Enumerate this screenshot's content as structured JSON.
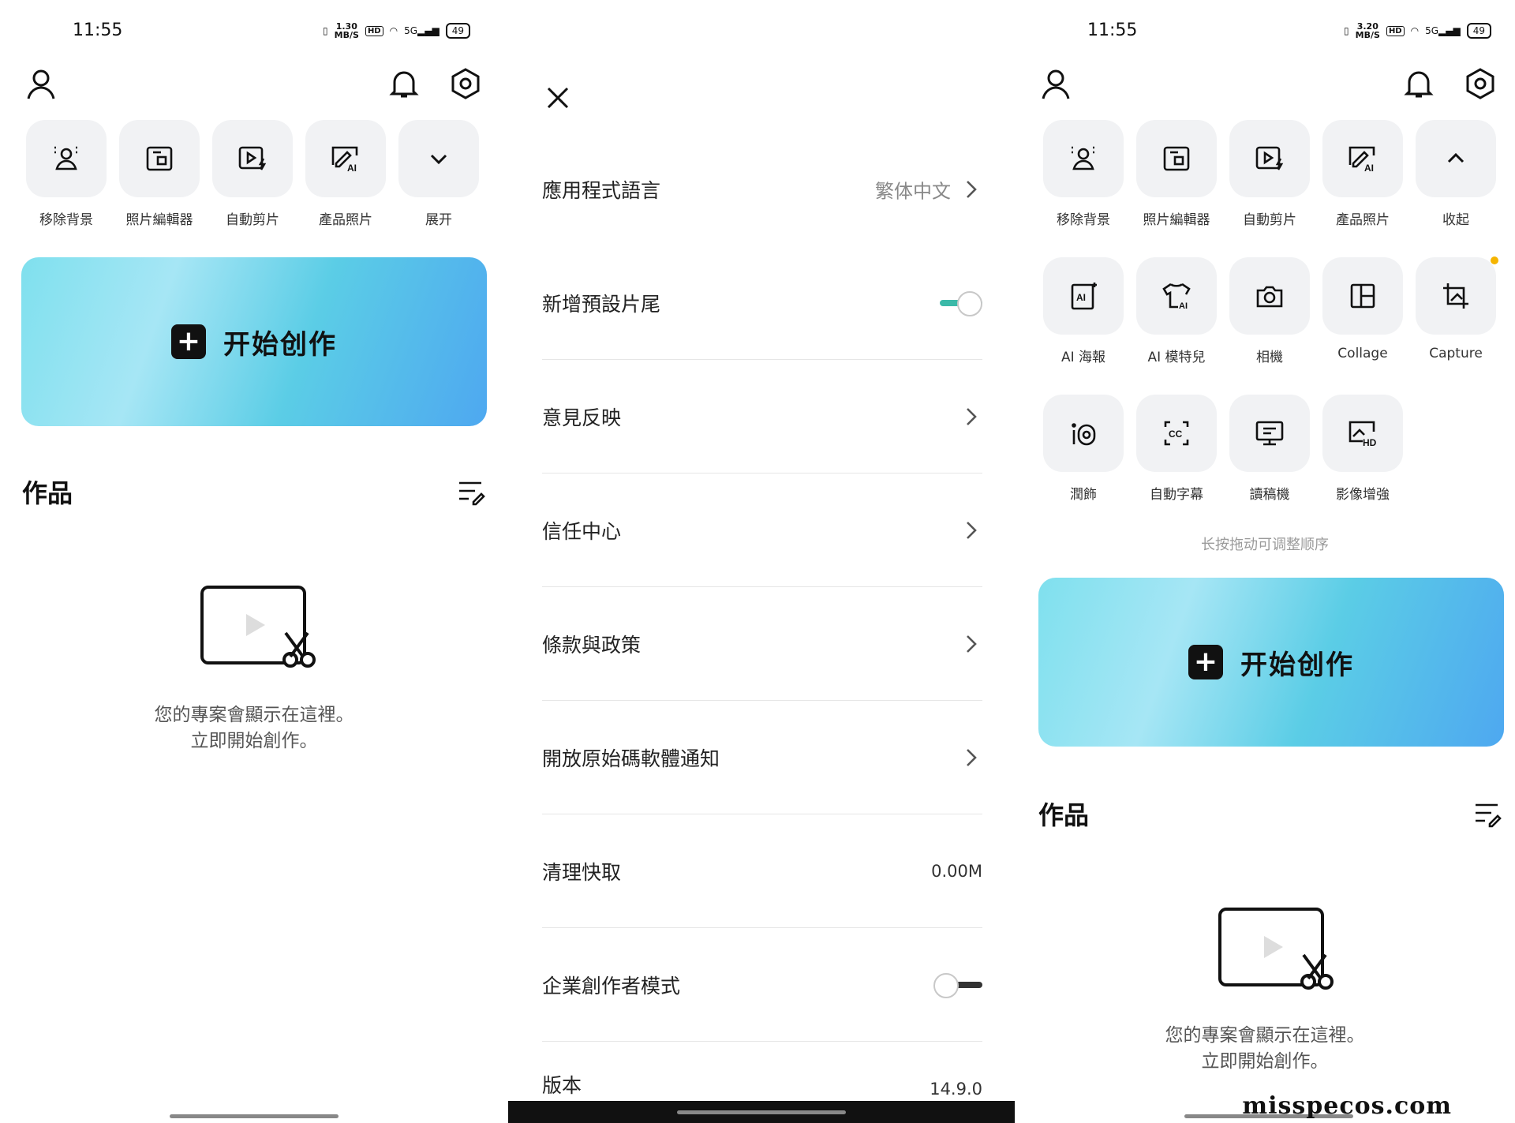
{
  "colors": {
    "accent_toggle": "#3bb9a8",
    "toggle_off": "#333333",
    "create_gradient": [
      "#7fe0ee",
      "#4ea8f0"
    ],
    "notify_dot": "#f5b400"
  },
  "status": {
    "time": "11:55",
    "speed_left": "1.30",
    "speed_right": "3.20",
    "speed_unit": "MB/S",
    "hd": "HD",
    "net": "5G",
    "battery": "49"
  },
  "home_left": {
    "tools": [
      {
        "label": "移除背景",
        "icon": "remove-background-icon"
      },
      {
        "label": "照片編輯器",
        "icon": "photo-editor-icon"
      },
      {
        "label": "自動剪片",
        "icon": "auto-cut-icon"
      },
      {
        "label": "產品照片",
        "icon": "product-photo-icon"
      },
      {
        "label": "展开",
        "icon": "chevron-down-icon"
      }
    ],
    "create_label": "开始创作",
    "works_title": "作品",
    "empty_line1": "您的專案會顯示在這裡。",
    "empty_line2": "立即開始創作。"
  },
  "settings": {
    "rows": [
      {
        "label": "應用程式語言",
        "value": "繁体中文"
      },
      {
        "label": "新增預設片尾",
        "toggle": true
      },
      {
        "label": "意見反映"
      },
      {
        "label": "信任中心"
      },
      {
        "label": "條款與政策"
      },
      {
        "label": "開放原始碼軟體通知"
      },
      {
        "label": "清理快取",
        "value": "0.00M"
      },
      {
        "label": "企業創作者模式",
        "toggle": false
      },
      {
        "label": "版本",
        "value": "14.9.0"
      }
    ]
  },
  "home_right": {
    "tools": [
      {
        "label": "移除背景",
        "icon": "remove-background-icon"
      },
      {
        "label": "照片編輯器",
        "icon": "photo-editor-icon"
      },
      {
        "label": "自動剪片",
        "icon": "auto-cut-icon"
      },
      {
        "label": "產品照片",
        "icon": "product-photo-icon"
      },
      {
        "label": "收起",
        "icon": "chevron-up-icon"
      },
      {
        "label": "AI 海報",
        "icon": "ai-poster-icon"
      },
      {
        "label": "AI 模特兒",
        "icon": "ai-model-icon"
      },
      {
        "label": "相機",
        "icon": "camera-icon"
      },
      {
        "label": "Collage",
        "icon": "collage-icon"
      },
      {
        "label": "Capture",
        "icon": "capture-icon"
      },
      {
        "label": "潤飾",
        "icon": "retouch-icon"
      },
      {
        "label": "自動字幕",
        "icon": "auto-caption-icon"
      },
      {
        "label": "讀稿機",
        "icon": "teleprompter-icon"
      },
      {
        "label": "影像增強",
        "icon": "image-enhance-icon"
      }
    ],
    "hint": "长按拖动可调整顺序",
    "create_label": "开始创作",
    "works_title": "作品",
    "empty_line1": "您的專案會顯示在這裡。",
    "empty_line2": "立即開始創作。"
  },
  "watermark": "misspecos.com"
}
